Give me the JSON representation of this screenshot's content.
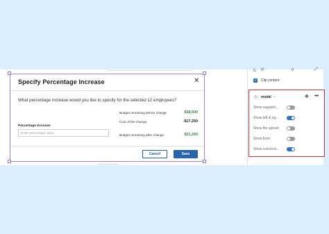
{
  "modal": {
    "title": "Specify Percentage Increase",
    "close_glyph": "✕",
    "question": "What percentage increase would  you like to specify for the selected 12 employees?",
    "stats": [
      {
        "label": "Budget remaining before change",
        "value": "$38,500",
        "color": "#2f8a3e"
      },
      {
        "label": "Cost of the change",
        "value": "-$17,250",
        "color": "#222222"
      },
      {
        "label": "Budget remaining after change",
        "value": "$21,250",
        "color": "#2f8a3e"
      }
    ],
    "field_label": "Percentage Increase",
    "field_placeholder": "Enter percentage value",
    "cancel_label": "Cancel",
    "save_label": "Save"
  },
  "right_panel": {
    "top_icon": "⊑",
    "top_val1": "0°",
    "top_val2": "0",
    "expand_glyph": "⤢",
    "clip_content_label": "Clip content",
    "component": {
      "icon": "◇",
      "name": "modal",
      "chevron": "⌄",
      "target_icon": "✥",
      "more_icon": "•••"
    },
    "properties": [
      {
        "label": "Show supporti...",
        "on": false
      },
      {
        "label": "Show left & rig...",
        "on": true
      },
      {
        "label": "Show file upload",
        "on": false
      },
      {
        "label": "Show form",
        "on": false
      },
      {
        "label": "Show icons/clo...",
        "on": true
      }
    ],
    "bottom_text": "· · · · ·"
  },
  "colors": {
    "accent": "#2b6fd1",
    "highlight": "#d32f2f",
    "selection": "#a37cde",
    "primary_button": "#2764ae"
  }
}
